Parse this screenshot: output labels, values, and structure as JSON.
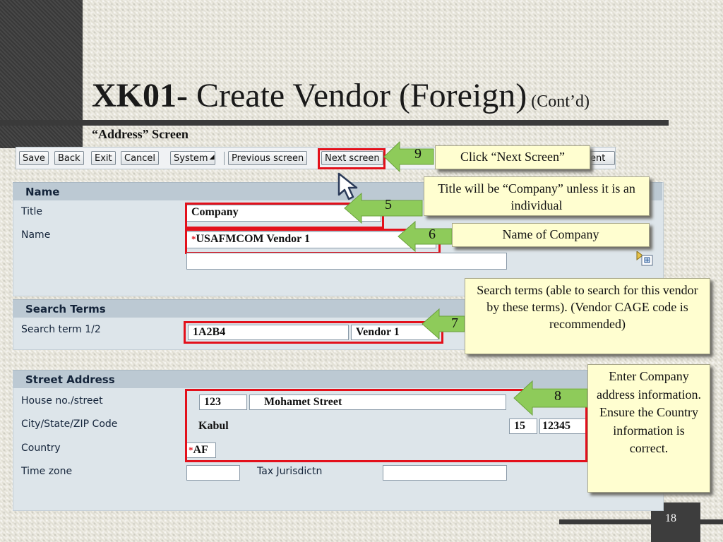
{
  "slide": {
    "title_bold": "XK01-",
    "title_main": " Create Vendor (Foreign)",
    "title_suffix": " (Cont’d)",
    "subtitle": "“Address” Screen",
    "page_number": "18"
  },
  "toolbar": {
    "buttons": [
      "Save",
      "Back",
      "Exit",
      "Cancel",
      "System",
      "Previous screen",
      "Next screen",
      "ent"
    ]
  },
  "sections": {
    "name": "Name",
    "search_terms": "Search Terms",
    "street_address": "Street Address"
  },
  "labels": {
    "title": "Title",
    "name": "Name",
    "search_term": "Search term 1/2",
    "house_street": "House no./street",
    "city_state_zip": "City/State/ZIP Code",
    "country": "Country",
    "time_zone": "Time zone",
    "tax_jurisdiction": "Tax Jurisdictn"
  },
  "values": {
    "title": "Company",
    "name1": "USAFMCOM Vendor 1",
    "name2": "",
    "search_term1": "1A2B4",
    "search_term2": "Vendor 1",
    "house_no": "123",
    "street": "Mohamet Street",
    "city": "Kabul",
    "state": "15",
    "zip": "12345",
    "country": "AF",
    "time_zone": "",
    "tax_jurisdiction": ""
  },
  "required_mark": "*",
  "callouts": {
    "c9": "Click “Next Screen”",
    "c5": "Title will be “Company” unless it is an individual",
    "c6": "Name of Company",
    "c7": "Search terms (able to search for this vendor by these terms). (Vendor CAGE code is recommended)",
    "c8": "Enter Company address information. Ensure the Country information is correct."
  },
  "steps": {
    "s9": "9",
    "s5": "5",
    "s6": "6",
    "s7": "7",
    "s8": "8"
  },
  "colors": {
    "highlight": "#e3101b",
    "arrow": "#8ecb5a",
    "callout": "#fffed0"
  }
}
